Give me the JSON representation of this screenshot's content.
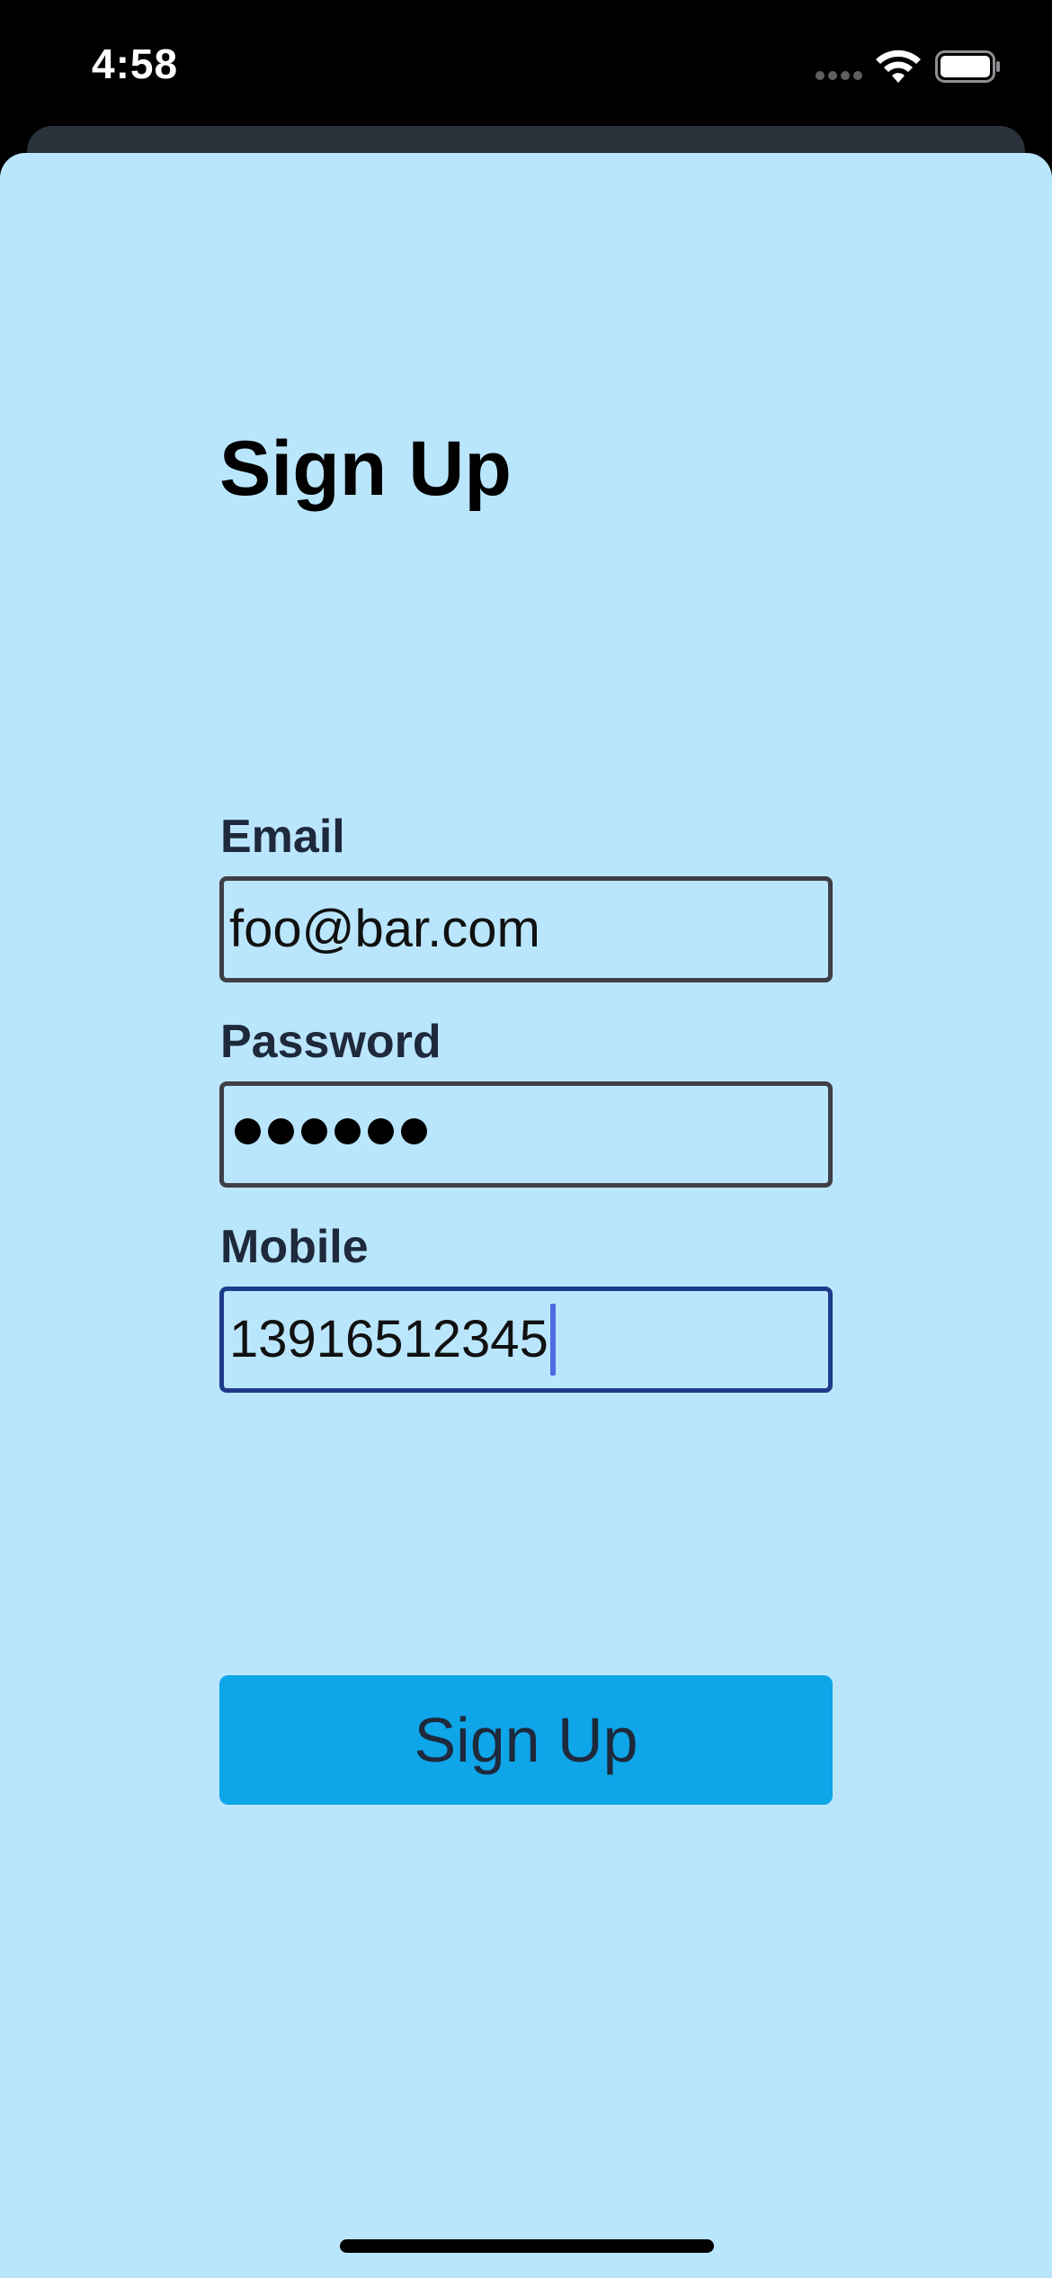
{
  "status_bar": {
    "time": "4:58",
    "cell_signal_icon": "cellular-signal-icon",
    "wifi_icon": "wifi-icon",
    "battery_icon": "battery-icon"
  },
  "form": {
    "title": "Sign Up",
    "email": {
      "label": "Email",
      "value": "foo@bar.com"
    },
    "password": {
      "label": "Password",
      "masked_length": 6
    },
    "mobile": {
      "label": "Mobile",
      "value": "13916512345",
      "focused": true
    },
    "submit_label": "Sign Up"
  },
  "colors": {
    "background": "#bae6fd",
    "button": "#0ea5e9",
    "focus_border": "#1e3a8a",
    "caret": "#4f6be0"
  }
}
